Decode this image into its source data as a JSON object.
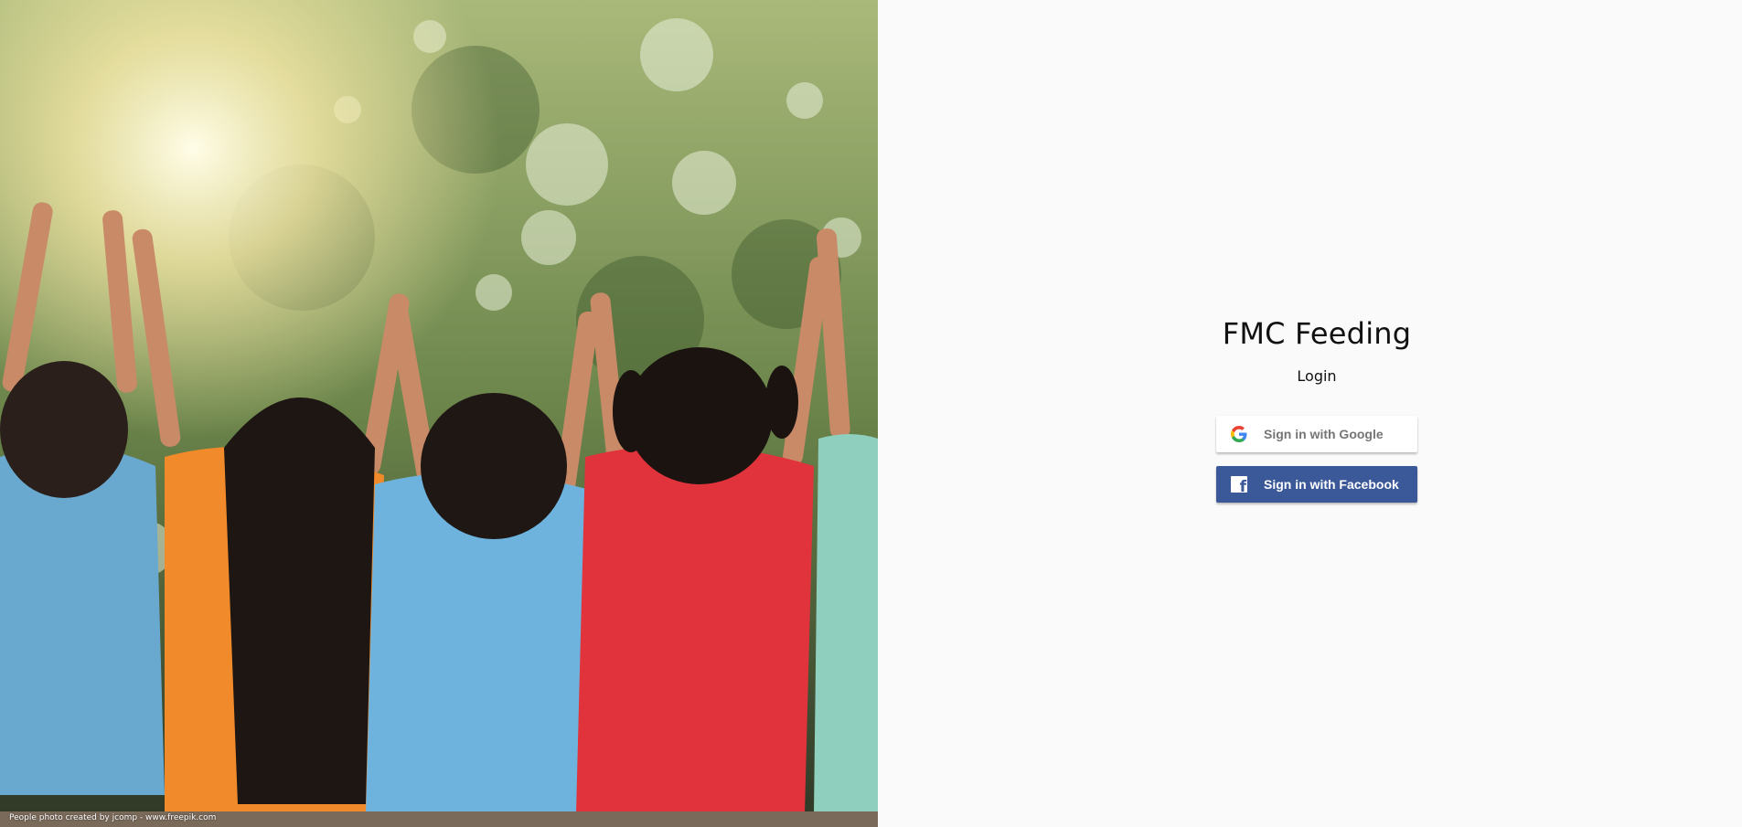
{
  "hero": {
    "alt_label": "children raising hands photo",
    "credit": "People photo created by jcomp - www.freepik.com"
  },
  "login": {
    "title": "FMC Feeding",
    "subtitle": "Login",
    "google_label": "Sign in with Google",
    "facebook_label": "Sign in with Facebook"
  },
  "colors": {
    "background": "#fafafa",
    "facebook_blue": "#3b5998",
    "google_text": "#757575"
  },
  "icons": {
    "google": "google-g-icon",
    "facebook": "facebook-f-icon"
  }
}
